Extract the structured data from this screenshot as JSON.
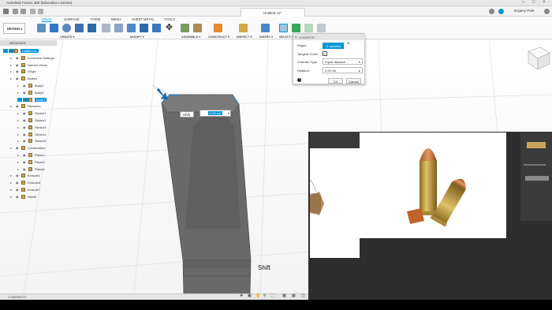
{
  "window": {
    "title": "Autodesk Fusion 360 (Education License)"
  },
  "tabbar": {
    "doc_title": "Untitled v1*",
    "user": "Evgeny Park"
  },
  "toolbar": {
    "workspace_tabs": [
      "SOLID",
      "SURFACE",
      "FORM",
      "MESH",
      "SHEET METAL",
      "TOOLS"
    ],
    "design_label": "DESIGN ▾",
    "groups": [
      "CREATE ▾",
      "MODIFY ▾",
      "ASSEMBLE ▾",
      "CONSTRUCT ▾",
      "INSPECT ▾",
      "INSERT ▾",
      "SELECT ▾"
    ]
  },
  "browser": {
    "header": "BROWSER",
    "items": [
      {
        "label": "Untitled v1",
        "indent": 0,
        "selected": true
      },
      {
        "label": "Document Settings",
        "indent": 1
      },
      {
        "label": "Named Views",
        "indent": 1
      },
      {
        "label": "Origin",
        "indent": 1
      },
      {
        "label": "Bodies",
        "indent": 1
      },
      {
        "label": "Body1",
        "indent": 2
      },
      {
        "label": "Body5",
        "indent": 2
      },
      {
        "label": "Body7",
        "indent": 2,
        "selected": true
      },
      {
        "label": "Sketches",
        "indent": 1
      },
      {
        "label": "Sketch1",
        "indent": 2
      },
      {
        "label": "Sketch2",
        "indent": 2
      },
      {
        "label": "Sketch3",
        "indent": 2
      },
      {
        "label": "Sketch4",
        "indent": 2
      },
      {
        "label": "Sketch5",
        "indent": 2
      },
      {
        "label": "Construction",
        "indent": 1
      },
      {
        "label": "Plane1",
        "indent": 2
      },
      {
        "label": "Plane2",
        "indent": 2
      },
      {
        "label": "Plane3",
        "indent": 2
      },
      {
        "label": "Extrude1",
        "indent": 1
      },
      {
        "label": "Extrude6",
        "indent": 1
      },
      {
        "label": "Extrude7",
        "indent": 1
      },
      {
        "label": "Fillet8",
        "indent": 1
      }
    ]
  },
  "chamfer": {
    "title": "CHAMFER",
    "edges_label": "Edges",
    "edges_value": "2 selected",
    "tangent_label": "Tangent Chain",
    "type_label": "Chamfer Type",
    "type_value": "Equal distance",
    "distance_label": "Distance",
    "distance_value": "0.00 cm",
    "ok": "OK",
    "cancel": "Cancel"
  },
  "viewport": {
    "shift_tip": "Shift",
    "distance_input": "0.00 cm",
    "shift_caption": "Shift"
  },
  "comments": {
    "label": "COMMENTS"
  },
  "colors": {
    "accent": "#0696d7",
    "body": "#6b6b6b"
  }
}
